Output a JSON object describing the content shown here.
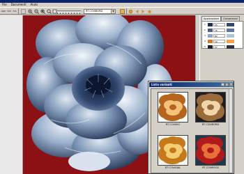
{
  "app": {
    "title": ""
  },
  "menu": {
    "items": [
      "File",
      "Documenti",
      "Aiuto"
    ]
  },
  "toolbar": {
    "open_label": "Ape",
    "save_label": "Sal",
    "print_label": "Ins",
    "mode_value": "RT COVIBORD",
    "buttons": [
      "zoom-in-icon",
      "zoom-out-icon",
      "zoom-fit-icon",
      "zoom-reset-icon",
      "zoom-window-icon"
    ]
  },
  "right_panel": {
    "tabs": [
      "Applicazione",
      "Conversioni"
    ],
    "colors": [
      {
        "index": "1",
        "value": "35",
        "color": "#1f2d52",
        "swatch2": "#33476e"
      },
      {
        "index": "2",
        "value": "76",
        "color": "#4a6288",
        "swatch2": "#5c78a0"
      },
      {
        "index": "3",
        "value": "82",
        "color": "#8fa6c2",
        "swatch2": "#b0c4da"
      },
      {
        "index": "4",
        "value": "10",
        "color": "#e07a18",
        "swatch2": "#f3a040"
      },
      {
        "index": "5",
        "value": "97",
        "color": "#1c1c2a",
        "swatch2": "#2e2e44"
      }
    ]
  },
  "thumbnail_window": {
    "title": "Lista varianti",
    "items": [
      {
        "label": "RT COVISIO",
        "bg": "#ffffff",
        "petal": "#b5651d",
        "light": "#f4c27a"
      },
      {
        "label": "RT COVIRORD",
        "bg": "#1e1e22",
        "petal": "#9a6a3a",
        "light": "#f0d6a8"
      },
      {
        "label": "RT COVIGIAL",
        "bg": "#f4f4f0",
        "petal": "#c47a1c",
        "light": "#f7cd72"
      },
      {
        "label": "RT COVIROSS",
        "bg": "#1c3a4a",
        "petal": "#b01a1a",
        "light": "#e8703a"
      }
    ]
  }
}
